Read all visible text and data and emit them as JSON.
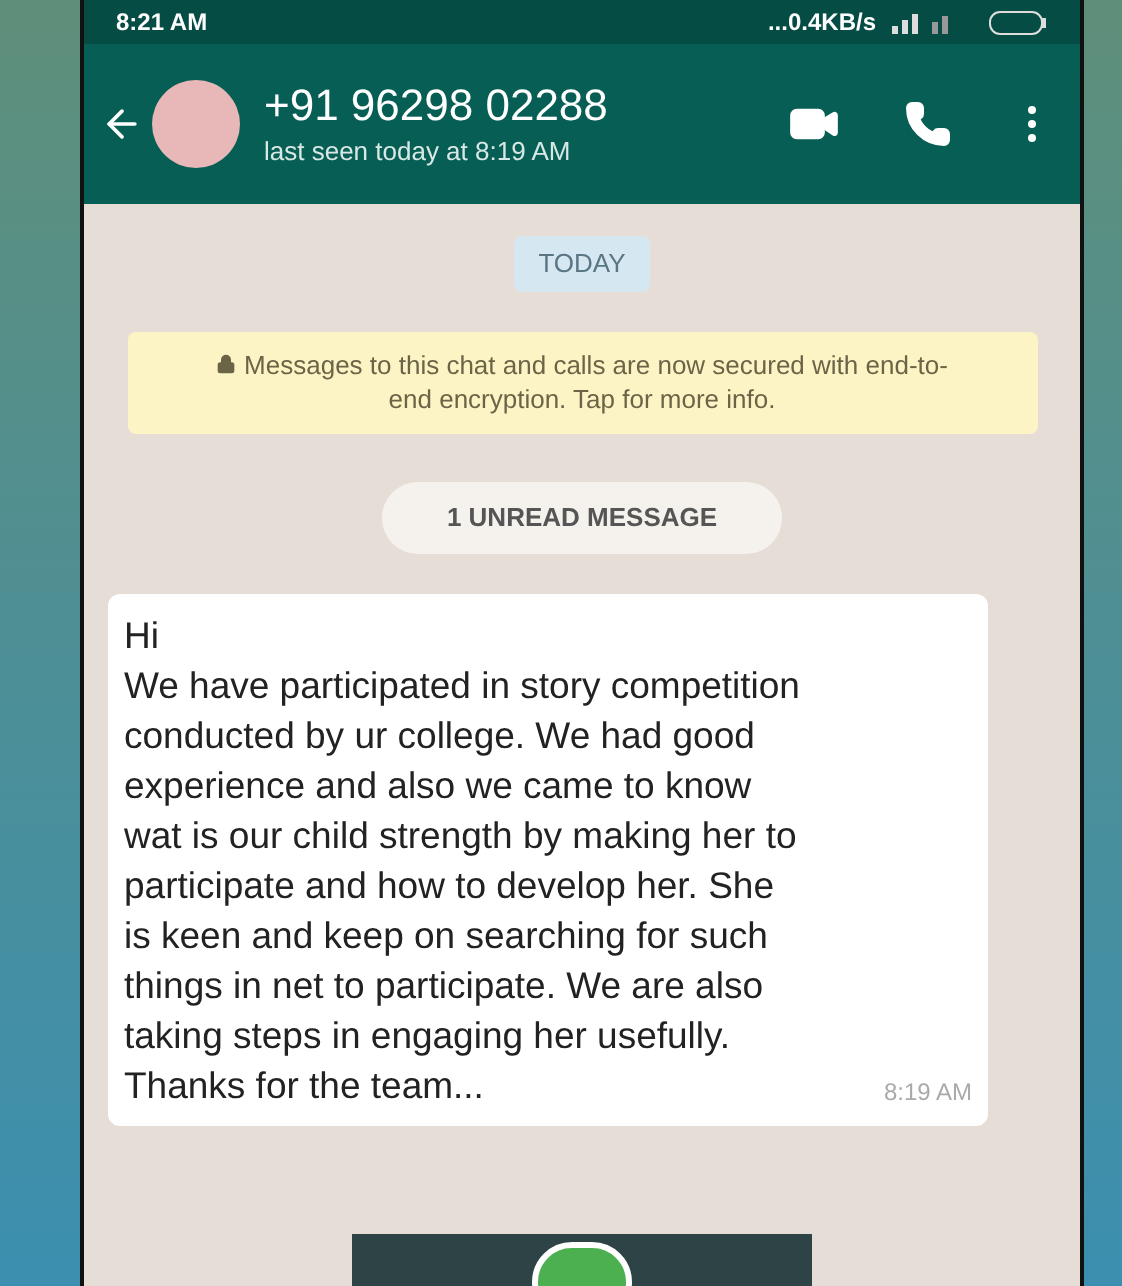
{
  "status_bar": {
    "time": "8:21 AM",
    "network_speed": "...0.4KB/s"
  },
  "header": {
    "title": "+91 96298 02288",
    "subtitle": "last seen today at 8:19 AM"
  },
  "date_chip": "TODAY",
  "encryption_notice": "Messages to this chat and calls are now secured with end-to-end encryption. Tap for more info.",
  "unread_chip": "1 UNREAD MESSAGE",
  "messages": [
    {
      "text": "Hi\nWe have participated in story competition\nconducted by ur college. We had good\nexperience and also we came to know\nwat is our child strength by making her to\nparticipate and how to develop her. She\nis keen and keep on searching for such\nthings in net to participate. We are also\ntaking steps in engaging her usefully.\nThanks for the team...",
      "time": "8:19 AM"
    }
  ]
}
